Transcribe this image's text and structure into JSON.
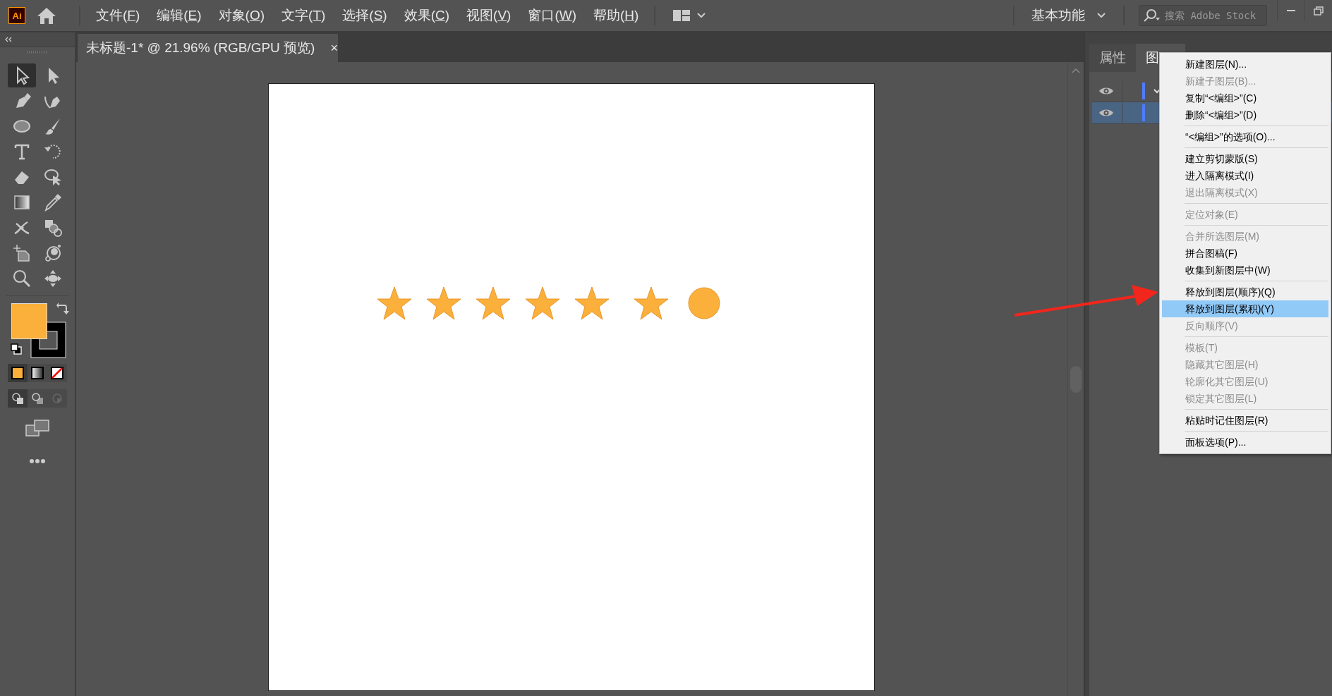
{
  "app": {
    "logo": "Ai"
  },
  "menu": [
    {
      "text": "文件(",
      "key": "F",
      "tail": ")"
    },
    {
      "text": "编辑(",
      "key": "E",
      "tail": ")"
    },
    {
      "text": "对象(",
      "key": "O",
      "tail": ")"
    },
    {
      "text": "文字(",
      "key": "T",
      "tail": ")"
    },
    {
      "text": "选择(",
      "key": "S",
      "tail": ")"
    },
    {
      "text": "效果(",
      "key": "C",
      "tail": ")"
    },
    {
      "text": "视图(",
      "key": "V",
      "tail": ")"
    },
    {
      "text": "窗口(",
      "key": "W",
      "tail": ")"
    },
    {
      "text": "帮助(",
      "key": "H",
      "tail": ")"
    }
  ],
  "workspace": "基本功能",
  "search": {
    "placeholder": "搜索 Adobe Stock"
  },
  "document_tab": {
    "title": "未标题-1* @ 21.96% (RGB/GPU 预览)",
    "close": "×"
  },
  "tools": [
    {
      "kind": "selection",
      "selected": true
    },
    {
      "kind": "direct",
      "selected": false
    },
    {
      "kind": "pen",
      "selected": false
    },
    {
      "kind": "curvature",
      "selected": false
    },
    {
      "kind": "ellipse",
      "selected": false
    },
    {
      "kind": "brush",
      "selected": false
    },
    {
      "kind": "type",
      "selected": false
    },
    {
      "kind": "rotate",
      "selected": false
    },
    {
      "kind": "eraser",
      "selected": false
    },
    {
      "kind": "lasso",
      "selected": false
    },
    {
      "kind": "gradient",
      "selected": false
    },
    {
      "kind": "eyedropper",
      "selected": false
    },
    {
      "kind": "puppet",
      "selected": false
    },
    {
      "kind": "shapebuilder",
      "selected": false
    },
    {
      "kind": "artboard",
      "selected": false
    },
    {
      "kind": "symbol",
      "selected": false
    },
    {
      "kind": "zoom",
      "selected": false
    },
    {
      "kind": "hand",
      "selected": false
    }
  ],
  "artwork": [
    {
      "kind": "star"
    },
    {
      "kind": "star"
    },
    {
      "kind": "star"
    },
    {
      "kind": "star"
    },
    {
      "kind": "star"
    },
    {
      "kind": "star"
    },
    {
      "kind": "circle"
    }
  ],
  "panel": {
    "tabs": [
      {
        "label": "属性",
        "selected": false
      },
      {
        "label": "图",
        "selected": true
      }
    ],
    "layers": [
      {
        "visible": true,
        "selected": false,
        "expanded": true
      },
      {
        "visible": true,
        "selected": true,
        "expanded": false
      }
    ]
  },
  "context_menu": {
    "groups": [
      [
        {
          "label": "新建图层(N)...",
          "disabled": false,
          "selected": false
        },
        {
          "label": "新建子图层(B)...",
          "disabled": true,
          "selected": false
        },
        {
          "label": "复制“<编组>”(C)",
          "disabled": false,
          "selected": false
        },
        {
          "label": "删除“<编组>”(D)",
          "disabled": false,
          "selected": false
        }
      ],
      [
        {
          "label": "“<编组>”的选项(O)...",
          "disabled": false,
          "selected": false
        }
      ],
      [
        {
          "label": "建立剪切蒙版(S)",
          "disabled": false,
          "selected": false
        },
        {
          "label": "进入隔离模式(I)",
          "disabled": false,
          "selected": false
        },
        {
          "label": "退出隔离模式(X)",
          "disabled": true,
          "selected": false
        }
      ],
      [
        {
          "label": "定位对象(E)",
          "disabled": true,
          "selected": false
        }
      ],
      [
        {
          "label": "合并所选图层(M)",
          "disabled": true,
          "selected": false
        },
        {
          "label": "拼合图稿(F)",
          "disabled": false,
          "selected": false
        },
        {
          "label": "收集到新图层中(W)",
          "disabled": false,
          "selected": false
        }
      ],
      [
        {
          "label": "释放到图层(顺序)(Q)",
          "disabled": false,
          "selected": false
        },
        {
          "label": "释放到图层(累积)(Y)",
          "disabled": false,
          "selected": true
        },
        {
          "label": "反向顺序(V)",
          "disabled": true,
          "selected": false
        }
      ],
      [
        {
          "label": "模板(T)",
          "disabled": true,
          "selected": false
        },
        {
          "label": "隐藏其它图层(H)",
          "disabled": true,
          "selected": false
        },
        {
          "label": "轮廓化其它图层(U)",
          "disabled": true,
          "selected": false
        },
        {
          "label": "锁定其它图层(L)",
          "disabled": true,
          "selected": false
        }
      ],
      [
        {
          "label": "粘贴时记住图层(R)",
          "disabled": false,
          "selected": false
        }
      ],
      [
        {
          "label": "面板选项(P)...",
          "disabled": false,
          "selected": false
        }
      ]
    ]
  }
}
